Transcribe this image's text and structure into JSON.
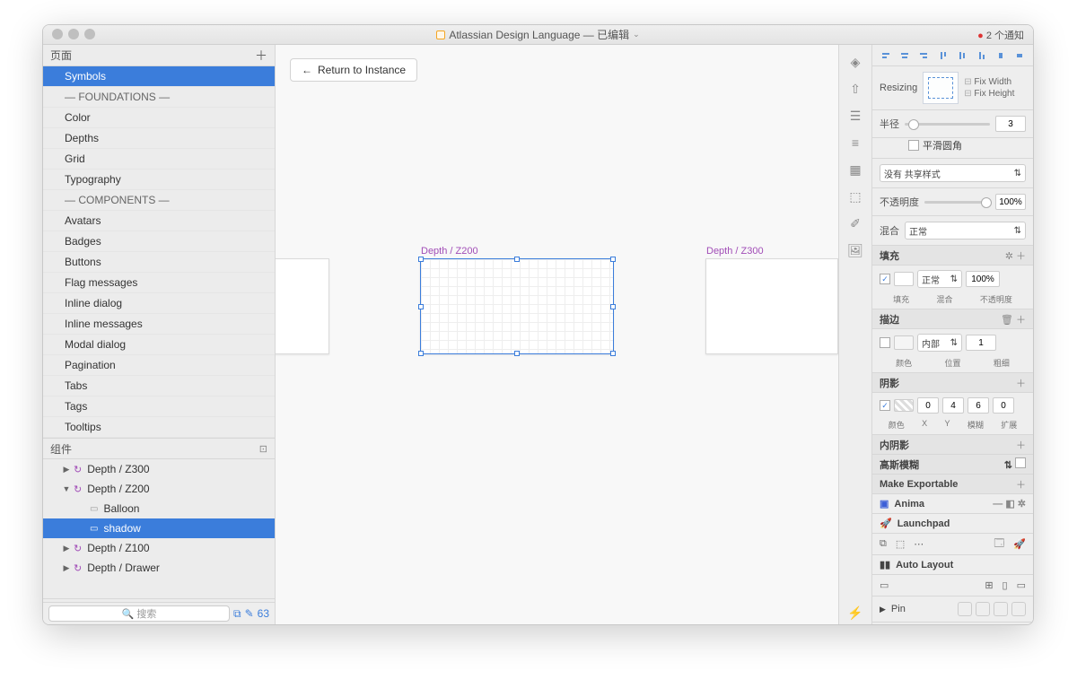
{
  "titlebar": {
    "title": "Atlassian Design Language — 已编辑",
    "notifications": "2 个通知"
  },
  "left": {
    "pages_header": "页面",
    "pages": [
      "Symbols",
      "— FOUNDATIONS —",
      "Color",
      "Depths",
      "Grid",
      "Typography",
      "— COMPONENTS —",
      "Avatars",
      "Badges",
      "Buttons",
      "Flag messages",
      "Inline dialog",
      "Inline messages",
      "Modal dialog",
      "Pagination",
      "Tabs",
      "Tags",
      "Tooltips"
    ],
    "components_header": "组件",
    "layers": [
      {
        "label": "Depth / Z300",
        "depth": 1,
        "symbol": true,
        "disclosure": "▶"
      },
      {
        "label": "Depth / Z200",
        "depth": 1,
        "symbol": true,
        "disclosure": "▼"
      },
      {
        "label": "Balloon",
        "depth": 2,
        "symbol": false
      },
      {
        "label": "shadow",
        "depth": 2,
        "symbol": false,
        "selected": true
      },
      {
        "label": "Depth / Z100",
        "depth": 1,
        "symbol": true,
        "disclosure": "▶"
      },
      {
        "label": "Depth / Drawer",
        "depth": 1,
        "symbol": true,
        "disclosure": "▶"
      }
    ],
    "search_placeholder": "搜索",
    "mirror_count": "63"
  },
  "canvas": {
    "return_label": "Return to Instance",
    "artboards": {
      "a2": "Depth / Z200",
      "a3": "Depth / Z300"
    }
  },
  "inspector": {
    "resizing": {
      "label": "Resizing",
      "fix_w": "Fix Width",
      "fix_h": "Fix Height"
    },
    "radius": {
      "label": "半径",
      "value": "3",
      "smooth": "平滑圆角"
    },
    "shared_style": "没有 共享样式",
    "opacity": {
      "label": "不透明度",
      "value": "100%"
    },
    "blend": {
      "label": "混合",
      "value": "正常"
    },
    "fill": {
      "header": "填充",
      "blend": "正常",
      "opacity": "100%",
      "sub_fill": "填充",
      "sub_blend": "混合",
      "sub_op": "不透明度"
    },
    "border": {
      "header": "描边",
      "pos": "内部",
      "thick": "1",
      "sub_color": "颜色",
      "sub_pos": "位置",
      "sub_thick": "粗细"
    },
    "shadow": {
      "header": "阴影",
      "x": "0",
      "y": "4",
      "blur": "6",
      "spread": "0",
      "sub_color": "颜色",
      "sub_x": "X",
      "sub_y": "Y",
      "sub_blur": "模糊",
      "sub_spread": "扩展"
    },
    "inner_shadow": "内阴影",
    "gaussian": "高斯模糊",
    "exportable": "Make Exportable",
    "anima": "Anima",
    "launchpad": "Launchpad",
    "autolayout": "Auto Layout",
    "pin": "Pin"
  }
}
